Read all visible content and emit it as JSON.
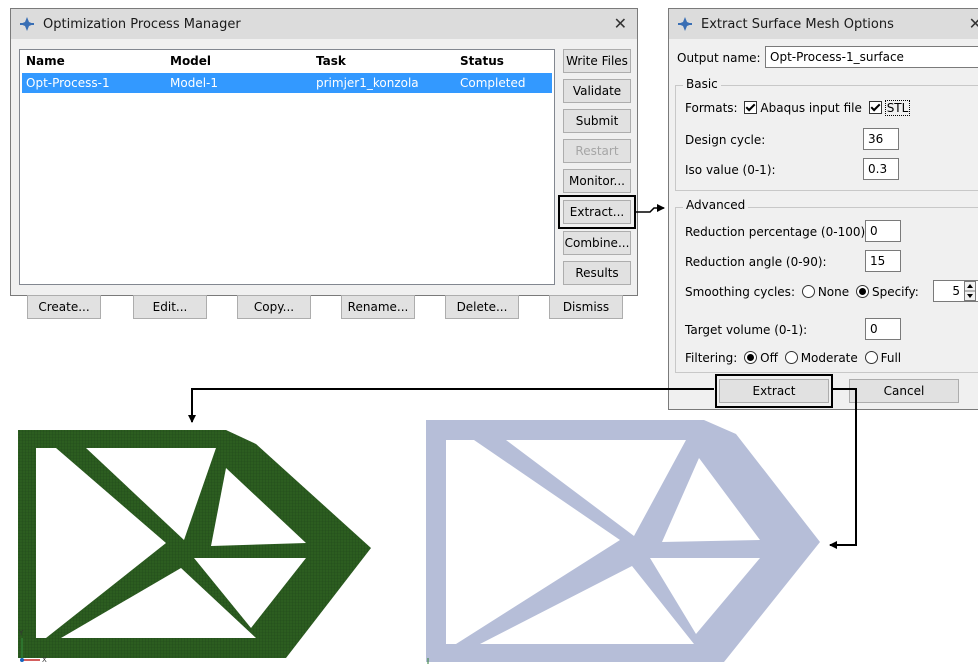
{
  "opm": {
    "title": "Optimization Process Manager",
    "columns": [
      "Name",
      "Model",
      "Task",
      "Status"
    ],
    "rows": [
      [
        "Opt-Process-1",
        "Model-1",
        "primjer1_konzola",
        "Completed"
      ]
    ],
    "side_buttons": {
      "write_files": "Write Files",
      "validate": "Validate",
      "submit": "Submit",
      "restart": "Restart",
      "monitor": "Monitor...",
      "extract": "Extract...",
      "combine": "Combine...",
      "results": "Results"
    },
    "bottom_buttons": {
      "create": "Create...",
      "edit": "Edit...",
      "copy": "Copy...",
      "rename": "Rename...",
      "delete": "Delete...",
      "dismiss": "Dismiss"
    },
    "close_glyph": "✕"
  },
  "esm": {
    "title": "Extract Surface Mesh Options",
    "output_name_label": "Output name:",
    "output_name_value": "Opt-Process-1_surface",
    "basic": {
      "legend": "Basic",
      "formats_label": "Formats:",
      "format_abaqus": "Abaqus input file",
      "format_stl": "STL",
      "design_cycle_label": "Design cycle:",
      "design_cycle_value": "36",
      "iso_label": "Iso value (0-1):",
      "iso_value": "0.3"
    },
    "advanced": {
      "legend": "Advanced",
      "reduction_pct_label": "Reduction percentage (0-100):",
      "reduction_pct_value": "0",
      "reduction_angle_label": "Reduction angle (0-90):",
      "reduction_angle_value": "15",
      "smoothing_label": "Smoothing cycles:",
      "smoothing_none": "None",
      "smoothing_specify": "Specify:",
      "smoothing_value": "5",
      "target_volume_label": "Target volume (0-1):",
      "target_volume_value": "0",
      "filtering_label": "Filtering:",
      "filtering_off": "Off",
      "filtering_moderate": "Moderate",
      "filtering_full": "Full"
    },
    "extract_button": "Extract",
    "cancel_button": "Cancel"
  },
  "triad": {
    "y": "Y",
    "x": "X"
  },
  "colors": {
    "mesh_result": "#2a5a1e",
    "surface_result": "#b6bed8",
    "selection": "#3399ff"
  }
}
